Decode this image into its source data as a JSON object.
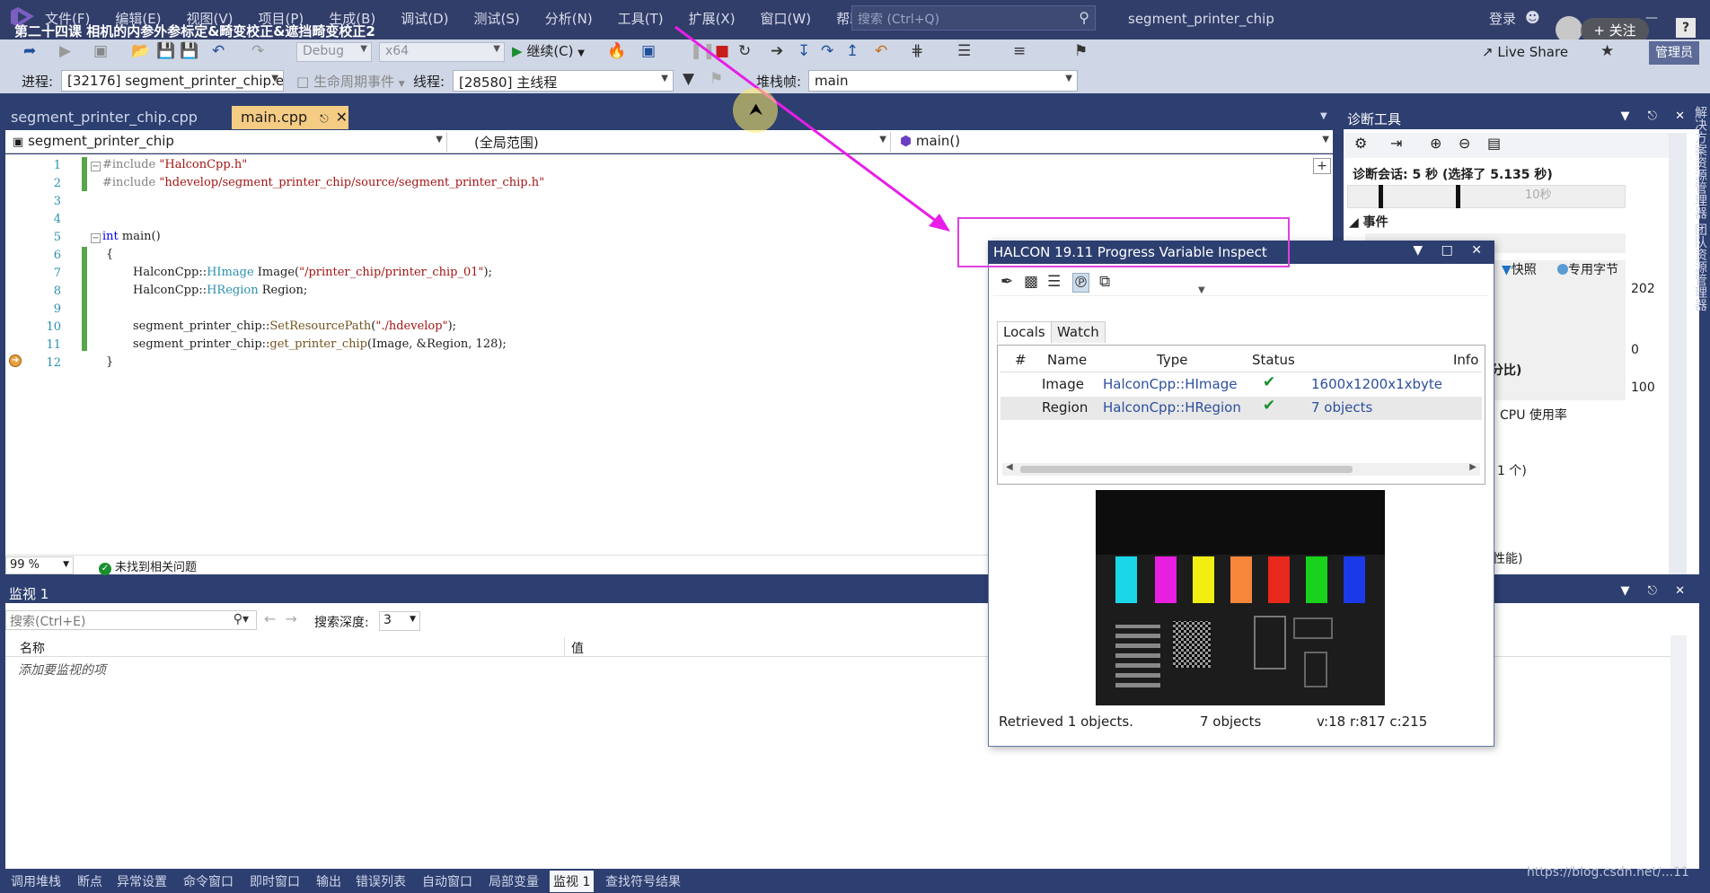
{
  "window": {
    "course_title": "第二十四课 相机的内参外参标定&畸变校正&遮挡畸变校正2",
    "menu": [
      "文件(F)",
      "编辑(E)",
      "视图(V)",
      "项目(P)",
      "生成(B)",
      "调试(D)",
      "测试(S)",
      "分析(N)",
      "工具(T)",
      "扩展(X)",
      "窗口(W)",
      "帮助(H)"
    ],
    "search_placeholder": "搜索 (Ctrl+Q)",
    "project_name": "segment_printer_chip",
    "login": "登录",
    "follow": "+ 关注",
    "help": "?"
  },
  "toolbar": {
    "config": "Debug",
    "platform": "x64",
    "continue": "继续(C)",
    "live_share": "Live Share",
    "admin": "管理员"
  },
  "debug_bar": {
    "process_label": "进程:",
    "process_value": "[32176] segment_printer_chip.e",
    "lifecycle": "生命周期事件",
    "thread_label": "线程:",
    "thread_value": "[28580] 主线程",
    "stack_label": "堆栈帧:",
    "stack_value": "main"
  },
  "editor": {
    "tab_inactive": "segment_printer_chip.cpp",
    "tab_active": "main.cpp",
    "nav_project": "segment_printer_chip",
    "nav_scope": "(全局范围)",
    "nav_member": "main()",
    "line_numbers": [
      "1",
      "2",
      "3",
      "4",
      "5",
      "6",
      "7",
      "8",
      "9",
      "10",
      "11",
      "12"
    ],
    "code": {
      "l1_pp": "#include ",
      "l1_str": "\"HalconCpp.h\"",
      "l2_pp": "#include ",
      "l2_str": "\"hdevelop/segment_printer_chip/source/segment_printer_chip.h\"",
      "l5_kw": "int",
      "l5_rest": " main()",
      "l6": "{",
      "l7_ns": "HalconCpp::",
      "l7_type": "HImage",
      "l7_mid": " Image(",
      "l7_str": "\"/printer_chip/printer_chip_01\"",
      "l7_end": ");",
      "l8_ns": "HalconCpp::",
      "l8_type": "HRegion",
      "l8_end": " Region;",
      "l10_ns": "segment_printer_chip::",
      "l10_fn": "SetResourcePath",
      "l10_open": "(",
      "l10_str": "\"./hdevelop\"",
      "l10_end": ");",
      "l11_ns": "segment_printer_chip::",
      "l11_fn": "get_printer_chip",
      "l11_end": "(Image, &Region, 128);",
      "l12": "}"
    },
    "zoom": "99 %",
    "issues": "未找到相关问题"
  },
  "diagnostics": {
    "title": "诊断工具",
    "session": "诊断会话: 5 秒 (选择了 5.135 秒)",
    "tick_10s": "10秒",
    "events": "事件",
    "snapshot": "快照",
    "private_bytes": "专用字节",
    "y_top": "202",
    "y_zero": "0",
    "ratio_label": "分比)",
    "cpu_top": "100",
    "cpu_label": "CPU 使用率",
    "count": "1 个)",
    "perf": "性能)",
    "side_tabs": "解决方案资源管理器 团队资源管理器"
  },
  "watch": {
    "title": "监视 1",
    "search_placeholder": "搜索(Ctrl+E)",
    "depth_label": "搜索深度:",
    "depth_value": "3",
    "col_name": "名称",
    "col_value": "值",
    "add_hint": "添加要监视的项"
  },
  "bottom_tabs": [
    "调用堆栈",
    "断点",
    "异常设置",
    "命令窗口",
    "即时窗口",
    "输出",
    "错误列表",
    "自动窗口",
    "局部变量",
    "监视 1",
    "查找符号结果"
  ],
  "watermark": "https://blog.csdn.net/...11",
  "halcon": {
    "title": "HALCON 19.11 Progress Variable Inspect",
    "tab_locals": "Locals",
    "tab_watch": "Watch",
    "cols": {
      "num": "#",
      "name": "Name",
      "type": "Type",
      "status": "Status",
      "info": "Info"
    },
    "rows": [
      {
        "name": "Image",
        "type": "HalconCpp::HImage",
        "status": "✔",
        "info": "1600x1200x1xbyte"
      },
      {
        "name": "Region",
        "type": "HalconCpp::HRegion",
        "status": "✔",
        "info": "7 objects"
      }
    ],
    "status_left": "Retrieved 1 objects.",
    "status_mid": "7 objects",
    "status_right": "v:18 r:817 c:215",
    "led_colors": [
      "#1bd6e8",
      "#e81ee0",
      "#f2ee12",
      "#f6863a",
      "#e8281c",
      "#18d21c",
      "#1a3ae8"
    ]
  }
}
